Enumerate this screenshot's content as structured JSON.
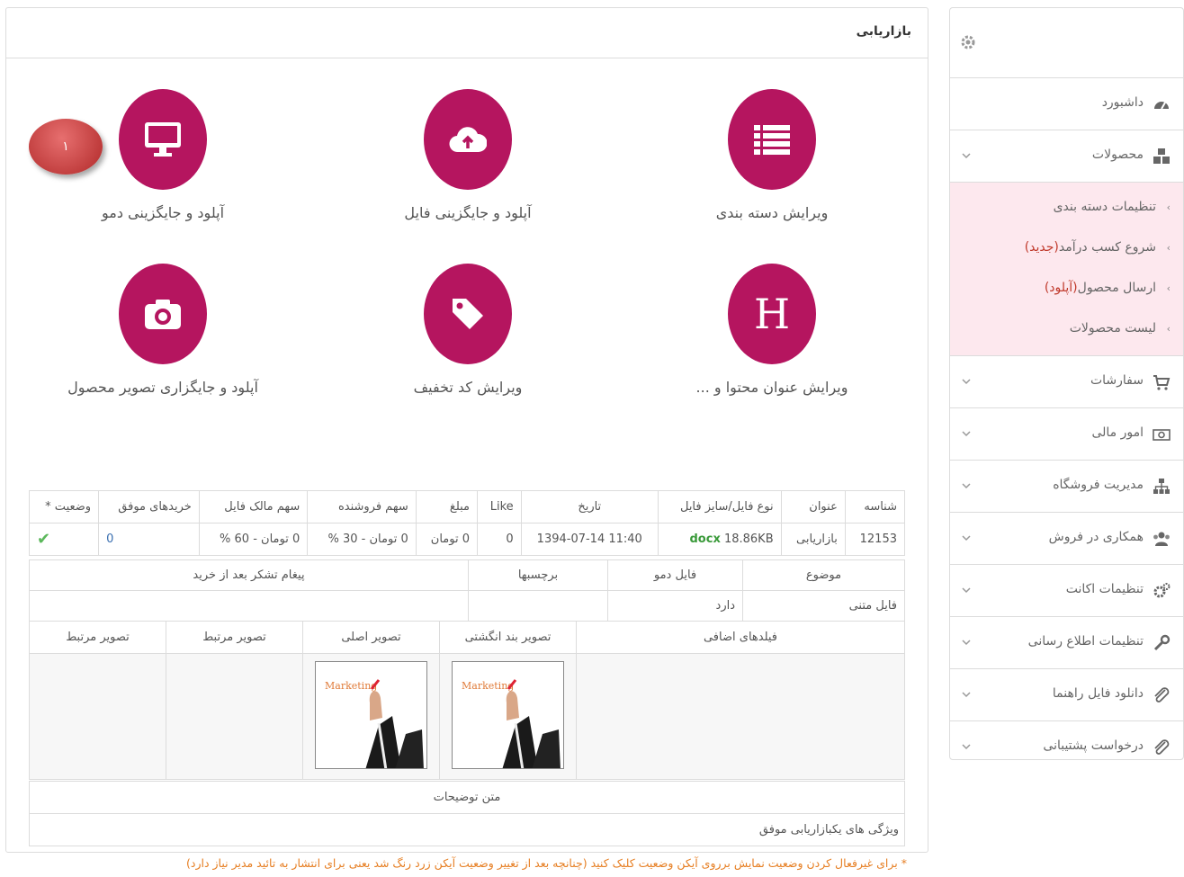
{
  "sidebar": {
    "items": [
      {
        "label": "داشبورد",
        "icon": "dashboard-icon"
      },
      {
        "label": "محصولات",
        "icon": "cubes-icon"
      },
      {
        "label": "سفارشات",
        "icon": "cart-icon"
      },
      {
        "label": "امور مالی",
        "icon": "money-icon"
      },
      {
        "label": "مدیریت فروشگاه",
        "icon": "sitemap-icon"
      },
      {
        "label": "همکاری در فروش",
        "icon": "users-icon"
      },
      {
        "label": "تنظیمات اکانت",
        "icon": "gears-icon"
      },
      {
        "label": "تنظیمات اطلاع رسانی",
        "icon": "wrench-icon"
      },
      {
        "label": "دانلود فایل راهنما",
        "icon": "paperclip-icon"
      },
      {
        "label": "درخواست پشتیبانی",
        "icon": "paperclip-icon"
      }
    ],
    "submenu": [
      {
        "label": "تنظیمات دسته بندی",
        "highlight": ""
      },
      {
        "label": "شروع کسب درآمد",
        "highlight": "(جدید)"
      },
      {
        "label": "ارسال محصول",
        "highlight": "(آپلود)"
      },
      {
        "label": "لیست محصولات",
        "highlight": ""
      }
    ]
  },
  "panel": {
    "title": "بازاریابی",
    "tiles": [
      {
        "label": "ویرایش دسته بندی",
        "icon": "list-icon"
      },
      {
        "label": "آپلود و جایگزینی فایل",
        "icon": "cloud-upload-icon"
      },
      {
        "label": "آپلود و جایگزینی دمو",
        "icon": "desktop-icon"
      },
      {
        "label": "ویرایش عنوان محتوا و ...",
        "icon": "header-icon"
      },
      {
        "label": "ویرایش کد تخفیف",
        "icon": "tag-icon"
      },
      {
        "label": "آپلود و جایگزاری تصویر محصول",
        "icon": "camera-icon"
      }
    ],
    "badge": "۱",
    "header_glyph": "H"
  },
  "table": {
    "headers": [
      "شناسه",
      "عنوان",
      "نوع فایل/سایز فایل",
      "تاریخ",
      "Like",
      "مبلغ",
      "سهم فروشنده",
      "سهم مالک فایل",
      "خریدهای موفق",
      "وضعیت *"
    ],
    "row": {
      "id": "12153",
      "title": "بازاریابی",
      "size": "18.86KB",
      "type": "docx",
      "date": "1394-07-14 11:40",
      "like": "0",
      "price": "0 تومان",
      "seller_share": "0 تومان - 30 %",
      "owner_share": "0 تومان - 60 %",
      "purchases": "0",
      "status_icon": "check-icon"
    }
  },
  "details": {
    "headers": [
      "موضوع",
      "فایل دمو",
      "برچسبها",
      "پیغام تشکر بعد از خرید"
    ],
    "values": [
      "فایل متنی",
      "دارد",
      "",
      ""
    ]
  },
  "images": {
    "headers": [
      "فیلدهای اضافی",
      "تصویر بند انگشتی",
      "تصویر اصلی",
      "تصویر مرتبط",
      "تصویر مرتبط"
    ],
    "thumb_text": "Marketing"
  },
  "description": {
    "label": "متن توضیحات",
    "value": "ویژگی های یکبازاریابی موفق"
  },
  "note": "* برای غیرفعال کردن وضعیت نمایش برروی آیکن وضعیت کلیک کنید (چنانچه بعد از تغییر وضعیت آیکن زرد رنگ شد یعنی برای انتشار به تائید مدیر نیاز دارد)",
  "colors": {
    "accent": "#b5155f",
    "submenu_bg": "#fde8ee",
    "note": "#e67e22",
    "badge": "#c0392b"
  }
}
